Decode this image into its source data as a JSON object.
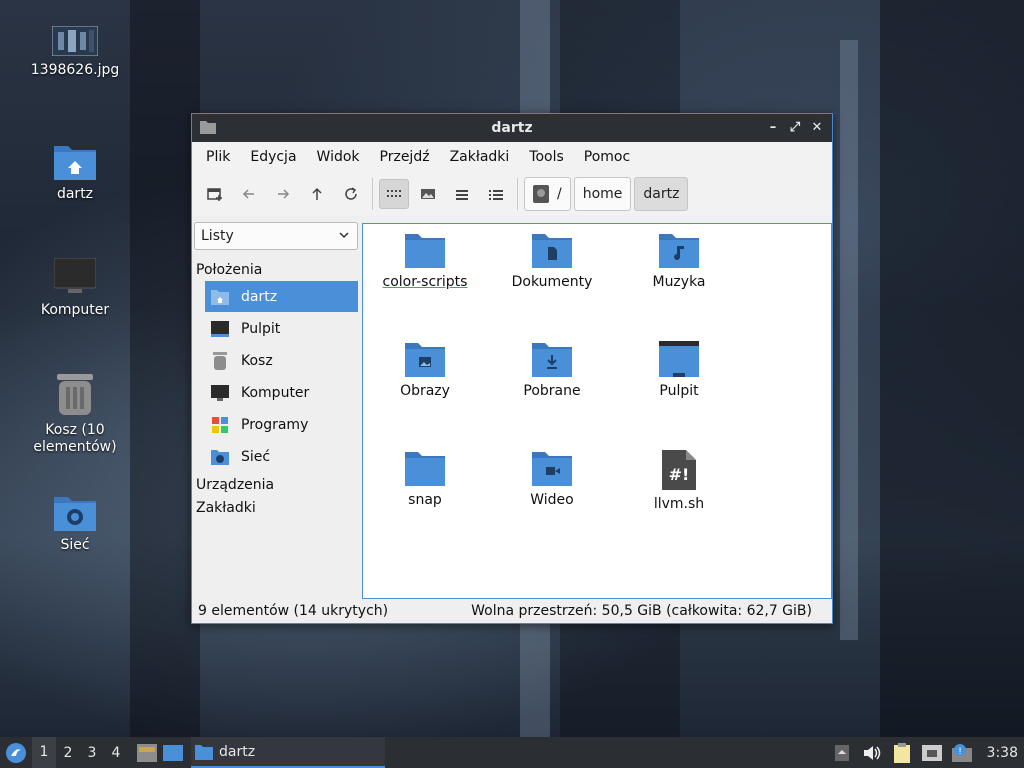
{
  "desktop": {
    "icons": [
      {
        "label": "1398626.jpg",
        "icon": "image-file-icon"
      },
      {
        "label": "dartz",
        "icon": "home-folder-icon"
      },
      {
        "label": "Komputer",
        "icon": "computer-icon"
      },
      {
        "label": "Kosz (10 elementów)",
        "icon": "trash-icon"
      },
      {
        "label": "Sieć",
        "icon": "network-folder-icon"
      }
    ]
  },
  "window": {
    "title": "dartz",
    "controls": {
      "minimize": "–",
      "maximize": "⤢",
      "close": "✕"
    },
    "menu": [
      "Plik",
      "Edycja",
      "Widok",
      "Przejdź",
      "Zakładki",
      "Tools",
      "Pomoc"
    ],
    "breadcrumb": [
      "/",
      "home",
      "dartz"
    ],
    "side_panel": {
      "view_mode": "Listy",
      "sections": {
        "places": "Położenia",
        "devices": "Urządzenia",
        "bookmarks": "Zakładki"
      },
      "places": [
        {
          "label": "dartz",
          "icon": "home-folder-icon",
          "selected": true
        },
        {
          "label": "Pulpit",
          "icon": "desktop-icon"
        },
        {
          "label": "Kosz",
          "icon": "trash-icon"
        },
        {
          "label": "Komputer",
          "icon": "computer-icon"
        },
        {
          "label": "Programy",
          "icon": "applications-icon"
        },
        {
          "label": "Sieć",
          "icon": "network-icon"
        }
      ]
    },
    "files": [
      {
        "name": "color-scripts",
        "icon": "folder-icon",
        "focused": true
      },
      {
        "name": "Dokumenty",
        "icon": "documents-folder-icon"
      },
      {
        "name": "Muzyka",
        "icon": "music-folder-icon"
      },
      {
        "name": "Obrazy",
        "icon": "pictures-folder-icon"
      },
      {
        "name": "Pobrane",
        "icon": "downloads-folder-icon"
      },
      {
        "name": "Pulpit",
        "icon": "desktop-folder-icon"
      },
      {
        "name": "snap",
        "icon": "folder-icon"
      },
      {
        "name": "Wideo",
        "icon": "videos-folder-icon"
      },
      {
        "name": "llvm.sh",
        "icon": "shell-script-icon"
      }
    ],
    "status": {
      "left": "9 elementów (14 ukrytych)",
      "right": "Wolna przestrzeń: 50,5 GiB (całkowita: 62,7 GiB)"
    }
  },
  "taskbar": {
    "workspaces": [
      "1",
      "2",
      "3",
      "4"
    ],
    "active_workspace": "1",
    "task_label": "dartz",
    "clock": "3:38"
  },
  "colors": {
    "accent": "#4a90d9",
    "folder": "#4a86c8",
    "titlebar": "#2c2f33"
  }
}
